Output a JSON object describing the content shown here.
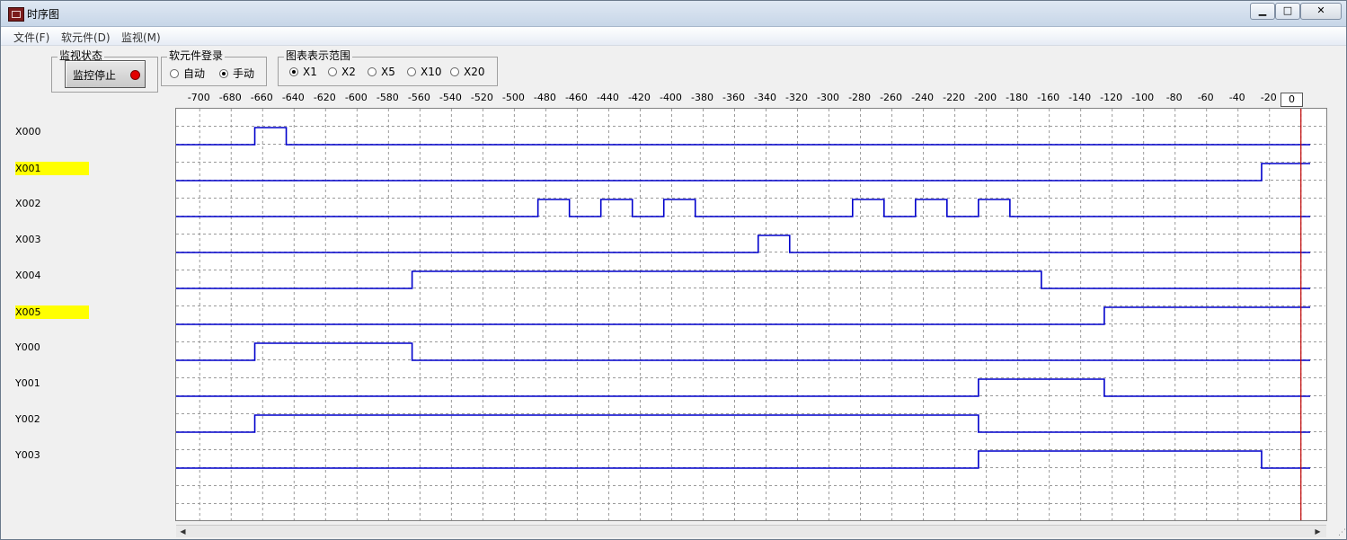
{
  "window": {
    "title": "时序图",
    "controls": {
      "minimize": "▁",
      "maximize": "□",
      "close": "✕"
    }
  },
  "menu": [
    "文件(F)",
    "软元件(D)",
    "监视(M)"
  ],
  "monitor_status": {
    "group_title": "监视状态",
    "button_label": "监控停止",
    "indicator_color": "#e20000"
  },
  "device_registration": {
    "group_title": "软元件登录",
    "options": [
      "自动",
      "手动"
    ],
    "selected": "手动"
  },
  "display_range": {
    "group_title": "图表表示范围",
    "options": [
      "X1",
      "X2",
      "X5",
      "X10",
      "X20"
    ],
    "selected": "X1"
  },
  "timeline": {
    "ticks": [
      "-700",
      "-680",
      "-660",
      "-640",
      "-620",
      "-600",
      "-580",
      "-560",
      "-540",
      "-520",
      "-500",
      "-480",
      "-460",
      "-440",
      "-420",
      "-400",
      "-380",
      "-360",
      "-340",
      "-320",
      "-300",
      "-280",
      "-260",
      "-240",
      "-220",
      "-200",
      "-180",
      "-160",
      "-140",
      "-120",
      "-100",
      "-80",
      "-60",
      "-40",
      "-20"
    ],
    "current": "0",
    "range": [
      -715,
      15
    ],
    "cursor_color": "#c00000",
    "signal_color": "#0000cc"
  },
  "signals": [
    {
      "name": "X000",
      "highlighted": false,
      "high": [
        [
          -665,
          -645
        ]
      ]
    },
    {
      "name": "X001",
      "highlighted": true,
      "high": [
        [
          -25,
          10
        ]
      ]
    },
    {
      "name": "X002",
      "highlighted": false,
      "high": [
        [
          -485,
          -465
        ],
        [
          -445,
          -425
        ],
        [
          -405,
          -385
        ],
        [
          -285,
          -265
        ],
        [
          -245,
          -225
        ],
        [
          -205,
          -185
        ]
      ]
    },
    {
      "name": "X003",
      "highlighted": false,
      "high": [
        [
          -345,
          -325
        ]
      ]
    },
    {
      "name": "X004",
      "highlighted": false,
      "high": [
        [
          -565,
          -165
        ]
      ]
    },
    {
      "name": "X005",
      "highlighted": true,
      "high": [
        [
          -125,
          10
        ]
      ]
    },
    {
      "name": "Y000",
      "highlighted": false,
      "high": [
        [
          -665,
          -565
        ]
      ]
    },
    {
      "name": "Y001",
      "highlighted": false,
      "high": [
        [
          -205,
          -125
        ]
      ]
    },
    {
      "name": "Y002",
      "highlighted": false,
      "high": [
        [
          -665,
          -205
        ]
      ]
    },
    {
      "name": "Y003",
      "highlighted": false,
      "high": [
        [
          -205,
          -25
        ]
      ]
    }
  ]
}
